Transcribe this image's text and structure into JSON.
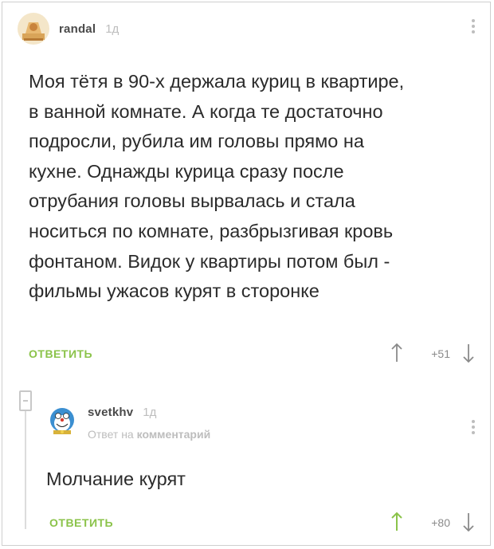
{
  "comment": {
    "username": "randal",
    "time": "1д",
    "lines": [
      "Моя тётя в 90-х держала куриц в квартире,",
      "в ванной комнате. А когда те достаточно",
      "подросли, рубила им головы прямо на",
      "кухне. Однажды курица сразу после",
      "отрубания головы вырвалась и стала",
      "носиться по комнате, разбрызгивая кровь",
      "фонтаном. Видок у квартиры потом был -",
      "фильмы ужасов курят в сторонке"
    ],
    "reply_label": "ОТВЕТИТЬ",
    "rating": "+51"
  },
  "reply": {
    "username": "svetkhv",
    "time": "1д",
    "reply_to_prefix": "Ответ на",
    "reply_to_link": "комментарий",
    "text": "Молчание курят",
    "reply_label": "ОТВЕТИТЬ",
    "rating": "+80"
  },
  "colors": {
    "accent_green": "#8bc34a",
    "muted": "#bdbdbd",
    "text": "#2b2b2b"
  },
  "icons": [
    "avatar-randal",
    "avatar-svetkhv",
    "more-icon",
    "arrow-up-icon",
    "arrow-down-icon",
    "collapse-icon"
  ]
}
